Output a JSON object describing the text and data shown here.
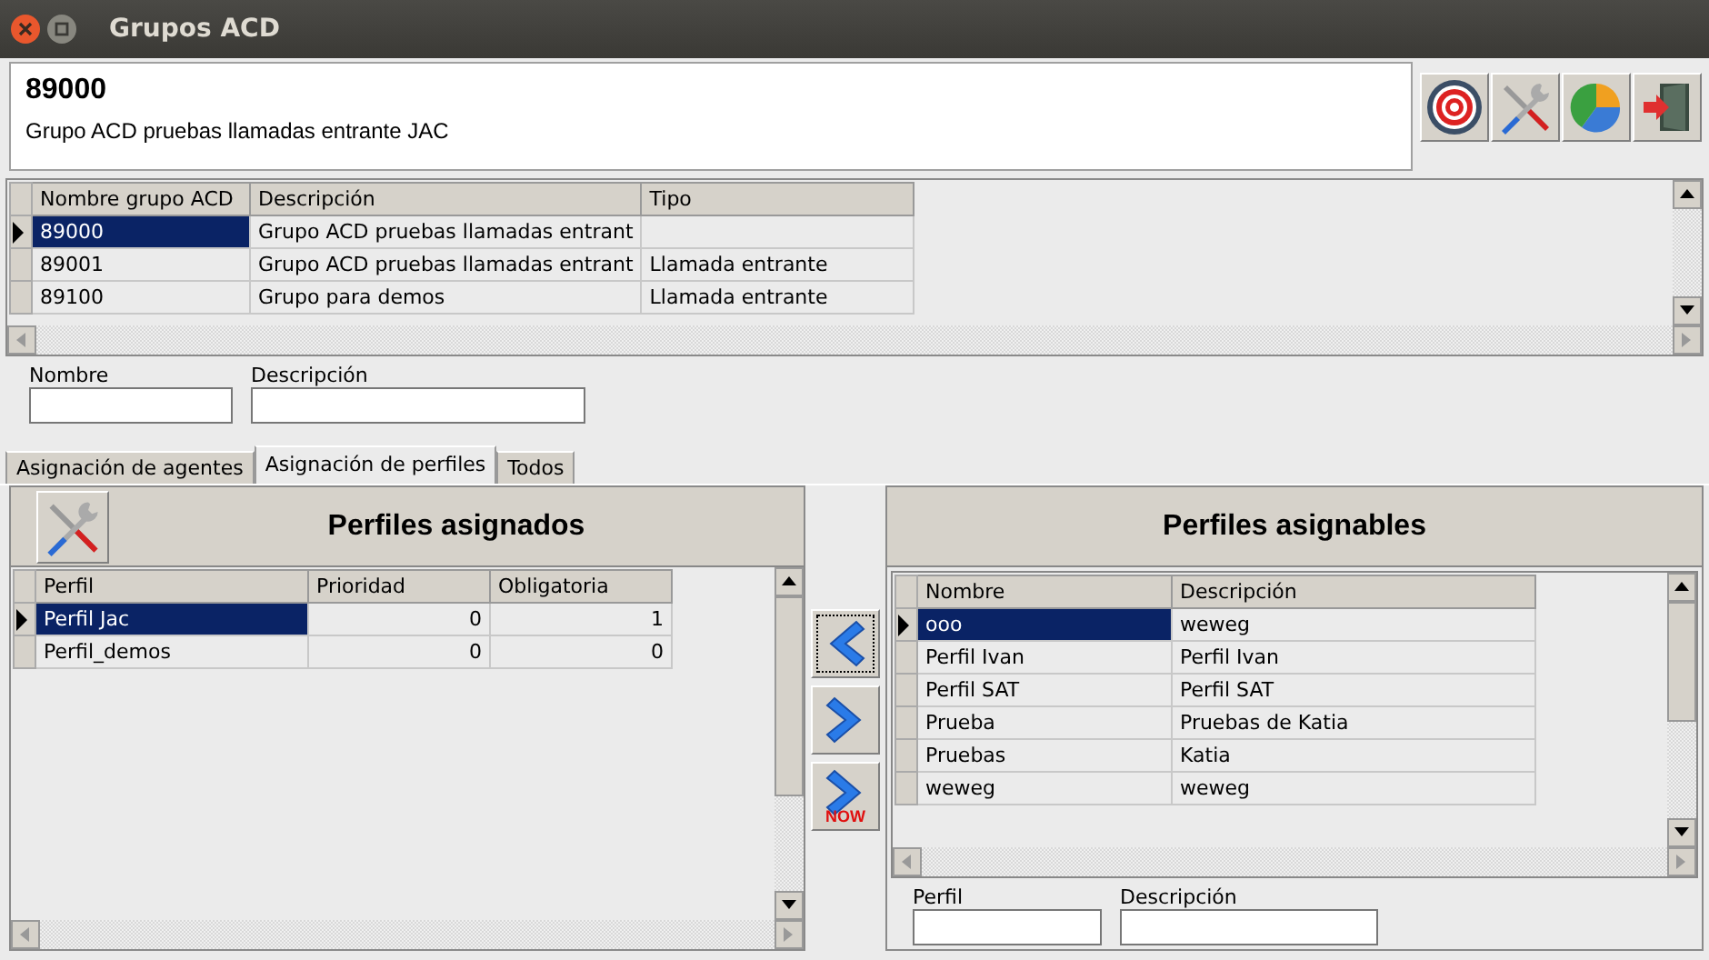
{
  "window": {
    "title": "Grupos ACD"
  },
  "header": {
    "code": "89000",
    "description": "Grupo ACD pruebas llamadas entrante JAC"
  },
  "groups_table": {
    "columns": [
      {
        "label": "Nombre grupo ACD",
        "kind": "text"
      },
      {
        "label": "Descripción",
        "kind": "text"
      },
      {
        "label": "Tipo",
        "kind": "text"
      }
    ],
    "rows": [
      {
        "cells": [
          "89000",
          "Grupo ACD pruebas llamadas entrant",
          ""
        ],
        "selected": true
      },
      {
        "cells": [
          "89001",
          "Grupo ACD pruebas llamadas entrant",
          "Llamada entrante"
        ],
        "selected": false
      },
      {
        "cells": [
          "89100",
          "Grupo para demos",
          "Llamada entrante"
        ],
        "selected": false
      }
    ]
  },
  "group_filters": [
    {
      "label": "Nombre"
    },
    {
      "label": "Descripción"
    }
  ],
  "tabs": [
    {
      "label": "Asignación de agentes",
      "selected": false
    },
    {
      "label": "Asignación de perfiles",
      "selected": true
    },
    {
      "label": "Todos",
      "selected": false
    }
  ],
  "assigned": {
    "title": "Perfiles asignados",
    "columns": [
      {
        "label": "Perfil",
        "kind": "text"
      },
      {
        "label": "Prioridad",
        "kind": "number"
      },
      {
        "label": "Obligatoria",
        "kind": "number"
      }
    ],
    "rows": [
      {
        "cells": [
          "Perfil Jac",
          "0",
          "1"
        ],
        "selected": true
      },
      {
        "cells": [
          "Perfil_demos",
          "0",
          "0"
        ],
        "selected": false
      }
    ]
  },
  "transfer_buttons": [
    {
      "kind": "left"
    },
    {
      "kind": "right"
    },
    {
      "kind": "all",
      "label": "NOW"
    }
  ],
  "assignable": {
    "title": "Perfiles asignables",
    "columns": [
      {
        "label": "Nombre",
        "kind": "text"
      },
      {
        "label": "Descripción",
        "kind": "text"
      }
    ],
    "rows": [
      {
        "cells": [
          "ooo",
          "weweg"
        ],
        "selected": true
      },
      {
        "cells": [
          "Perfil Ivan",
          "Perfil Ivan"
        ],
        "selected": false
      },
      {
        "cells": [
          "Perfil SAT",
          "Perfil SAT"
        ],
        "selected": false
      },
      {
        "cells": [
          "Prueba",
          "Pruebas de Katia"
        ],
        "selected": false
      },
      {
        "cells": [
          "Pruebas",
          "Katia"
        ],
        "selected": false
      },
      {
        "cells": [
          "weweg",
          "weweg"
        ],
        "selected": false
      }
    ],
    "filters": [
      {
        "label": "Perfil"
      },
      {
        "label": "Descripción"
      }
    ]
  }
}
